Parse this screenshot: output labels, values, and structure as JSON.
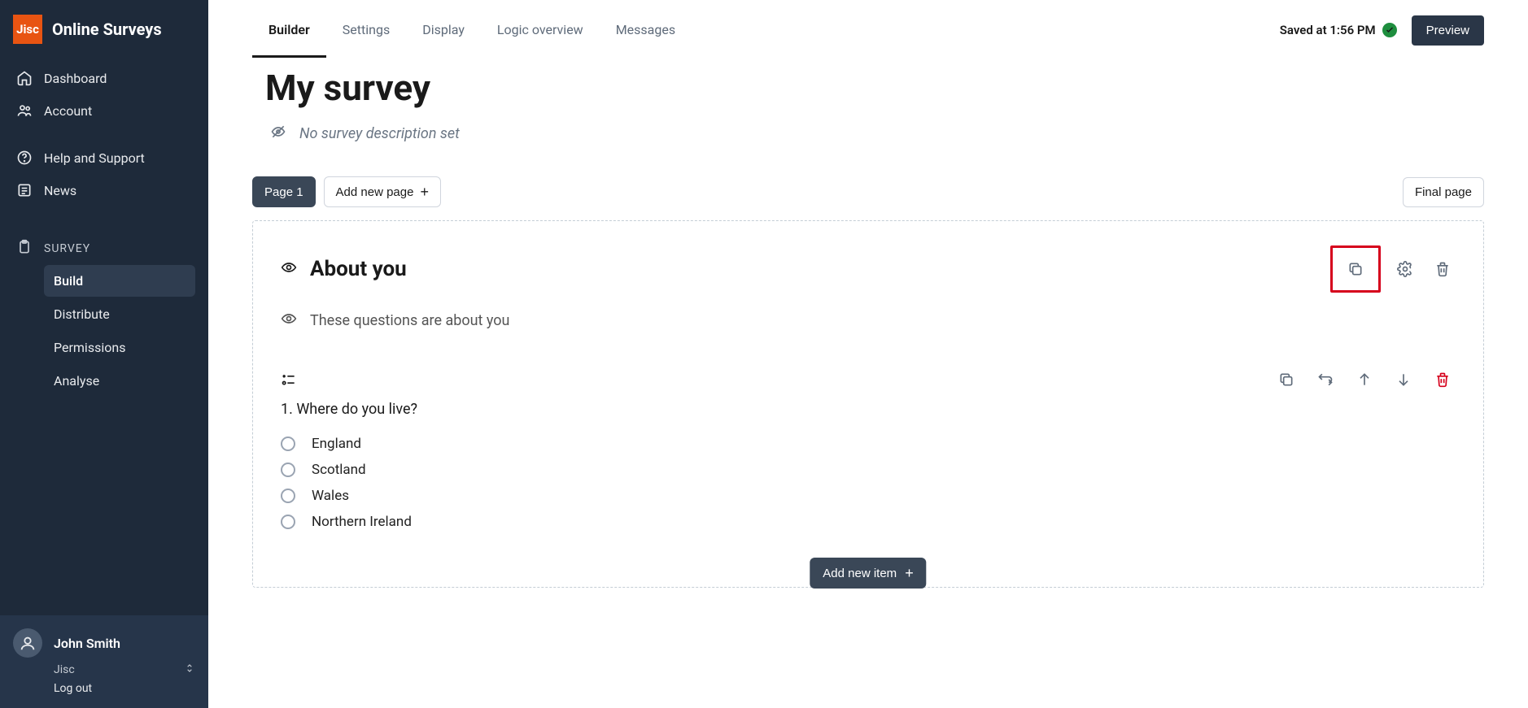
{
  "brand": {
    "logo_text": "Jisc",
    "name": "Online Surveys"
  },
  "sidebar": {
    "items": [
      {
        "label": "Dashboard"
      },
      {
        "label": "Account"
      },
      {
        "label": "Help and Support"
      },
      {
        "label": "News"
      }
    ],
    "group_label": "SURVEY",
    "sub_items": [
      {
        "label": "Build",
        "active": true
      },
      {
        "label": "Distribute"
      },
      {
        "label": "Permissions"
      },
      {
        "label": "Analyse"
      }
    ]
  },
  "user": {
    "name": "John Smith",
    "org": "Jisc",
    "logout": "Log out"
  },
  "tabs": [
    {
      "label": "Builder",
      "active": true
    },
    {
      "label": "Settings"
    },
    {
      "label": "Display"
    },
    {
      "label": "Logic overview"
    },
    {
      "label": "Messages"
    }
  ],
  "top": {
    "saved_text": "Saved at 1:56 PM",
    "preview": "Preview"
  },
  "survey": {
    "title": "My survey",
    "desc_placeholder": "No survey description set"
  },
  "pages": {
    "current": "Page 1",
    "add_new": "Add new page",
    "final": "Final page"
  },
  "section": {
    "title": "About you",
    "description": "These questions are about you"
  },
  "question": {
    "text": "1. Where do you live?",
    "options": [
      "England",
      "Scotland",
      "Wales",
      "Northern Ireland"
    ]
  },
  "add_item": "Add new item"
}
